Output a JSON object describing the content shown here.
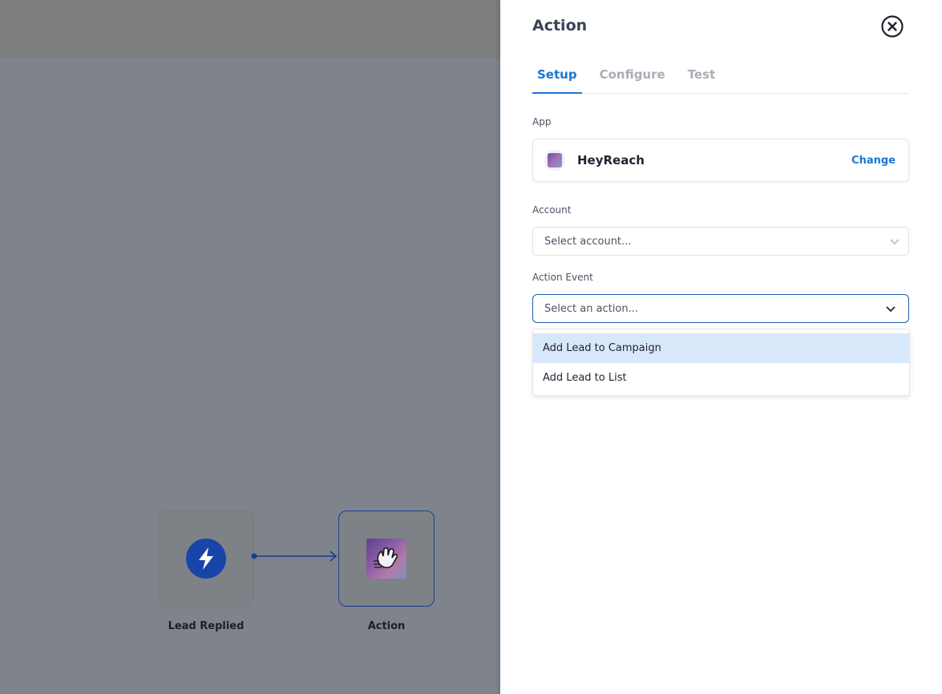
{
  "canvas": {
    "nodes": [
      {
        "label": "Lead Replied",
        "icon": "lightning-bolt-icon"
      },
      {
        "label": "Action",
        "icon": "heyreach-logo-icon"
      }
    ]
  },
  "panel": {
    "title": "Action",
    "tabs": [
      {
        "label": "Setup",
        "active": true
      },
      {
        "label": "Configure",
        "active": false
      },
      {
        "label": "Test",
        "active": false
      }
    ],
    "app": {
      "label": "App",
      "name": "HeyReach",
      "change_label": "Change"
    },
    "account": {
      "label": "Account",
      "placeholder": "Select account..."
    },
    "action_event": {
      "label": "Action Event",
      "placeholder": "Select an action...",
      "options": [
        {
          "label": "Add Lead to Campaign",
          "highlighted": true
        },
        {
          "label": "Add Lead to List",
          "highlighted": false
        }
      ]
    }
  },
  "colors": {
    "accent": "#1876d8",
    "focus_border": "#1f5cb0",
    "highlight": "#d8e8fb",
    "trigger_icon": "#1746a8"
  }
}
